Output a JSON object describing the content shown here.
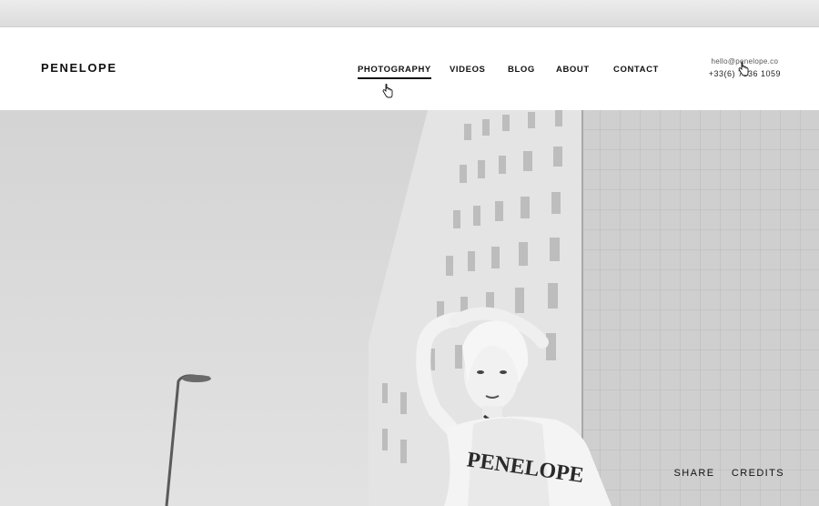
{
  "site": {
    "logo": "PENELOPE"
  },
  "nav": {
    "items": [
      {
        "label": "PHOTOGRAPHY",
        "active": true
      },
      {
        "label": "VIDEOS"
      },
      {
        "label": "BLOG"
      },
      {
        "label": "ABOUT"
      },
      {
        "label": "CONTACT"
      }
    ]
  },
  "contact": {
    "email": "hello@penelope.co",
    "phone": "+33(6) 7336 1059"
  },
  "hero": {
    "image_icon": "photo-portrait-icon",
    "shirt_text": "PENELOPE",
    "actions": [
      {
        "label": "SHARE"
      },
      {
        "label": "CREDITS"
      }
    ]
  },
  "colors": {
    "text": "#111111",
    "header_bg": "#ffffff",
    "photo_sky": "#d9d9d9"
  }
}
